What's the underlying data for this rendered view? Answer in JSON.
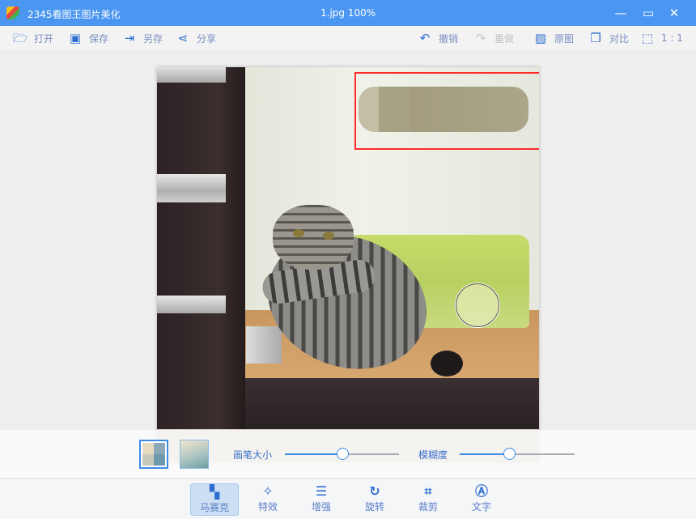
{
  "window": {
    "app_title": "2345看图王图片美化",
    "file_title": "1.jpg  100%"
  },
  "toolbar": {
    "open": "打开",
    "save": "保存",
    "save_as": "另存",
    "share": "分享",
    "undo": "撤销",
    "redo": "重做",
    "original": "原图",
    "compare": "对比",
    "actual_size": "1 : 1"
  },
  "mosaic_panel": {
    "brush_size_label": "画笔大小",
    "brush_size_value": 50,
    "blur_label": "模糊度",
    "blur_value": 43
  },
  "bottom_tools": [
    {
      "label": "马赛克",
      "active": true
    },
    {
      "label": "特效"
    },
    {
      "label": "增强"
    },
    {
      "label": "旋转"
    },
    {
      "label": "裁剪"
    },
    {
      "label": "文字"
    }
  ],
  "colors": {
    "accent": "#4a96f0",
    "selection": "#ff2b2b"
  }
}
